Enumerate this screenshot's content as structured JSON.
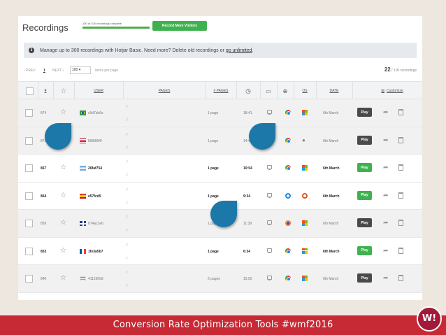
{
  "app": {
    "title": "Recordings",
    "progress": {
      "text": "100 of 100 recordings complete",
      "fraction": 1.0
    },
    "record_more_label": "Record More Visitors"
  },
  "info_bar": {
    "icon": "info-icon",
    "text": "Manage up to 300 recordings with Hotjar Basic. Need more? Delete old recordings or",
    "link_text": "go unlimited",
    "suffix": "."
  },
  "pager": {
    "prev": "‹ PREV",
    "page": "1",
    "next": "NEXT ›",
    "per_page": "100",
    "items_per_page": "items per page",
    "count": "22",
    "count_suffix": "/ 100 recordings"
  },
  "columns": {
    "num": "#",
    "user": "USER",
    "pages": "PAGES",
    "npages": "# PAGES",
    "duration_icon": "clock-icon",
    "device_icon": "monitor-icon",
    "browser_icon": "globe-icon",
    "os": "OS",
    "date": "DATE",
    "customize": "Customize"
  },
  "rows": [
    {
      "num": "874",
      "flag": "br",
      "user": "c9d7dc6e",
      "page1": "/",
      "page2": "/",
      "npages": "1 page",
      "duration": "18:41",
      "browser": "chrome",
      "os": "windows",
      "date": "6th March",
      "play": "Play",
      "watched": true
    },
    {
      "num": "871",
      "flag": "us",
      "user": "f388994f",
      "page1": "/",
      "page2": "/",
      "npages": "1 page",
      "duration": "14:44",
      "browser": "chrome",
      "os": "apple",
      "date": "6th March",
      "play": "Play",
      "watched": true
    },
    {
      "num": "867",
      "flag": "ar",
      "user": "26faf754",
      "page1": "/",
      "page2": "/",
      "npages": "1 page",
      "duration": "10:54",
      "browser": "chrome",
      "os": "windows",
      "date": "6th March",
      "play": "Play",
      "watched": false
    },
    {
      "num": "864",
      "flag": "es",
      "user": "e57fcd5",
      "page1": "/",
      "page2": "/",
      "npages": "1 page",
      "duration": "9:34",
      "browser": "ie",
      "os": "ubuntu",
      "date": "6th March",
      "play": "Play",
      "watched": false
    },
    {
      "num": "859",
      "flag": "gb",
      "user": "074ac1e6",
      "page1": "/",
      "page2": "/",
      "npages": "1 page",
      "duration": "11:39",
      "browser": "firefox",
      "os": "windows",
      "date": "6th March",
      "play": "Play",
      "watched": true
    },
    {
      "num": "853",
      "flag": "fr",
      "user": "1fe3a5b7",
      "page1": "/",
      "page2": "/",
      "npages": "1 page",
      "duration": "6:34",
      "browser": "chrome",
      "os": "windows",
      "date": "6th March",
      "play": "Play",
      "watched": false
    },
    {
      "num": "840",
      "flag": "il",
      "user": "4111909d",
      "page1": "/",
      "page2": "/",
      "npages": "2 pages",
      "duration": "15:02",
      "browser": "chrome",
      "os": "windows",
      "date": "6th March",
      "play": "Play",
      "watched": true
    }
  ],
  "footer": {
    "text": "Conversion Rate Optimization Tools #wmf2016",
    "logo": "W!"
  }
}
